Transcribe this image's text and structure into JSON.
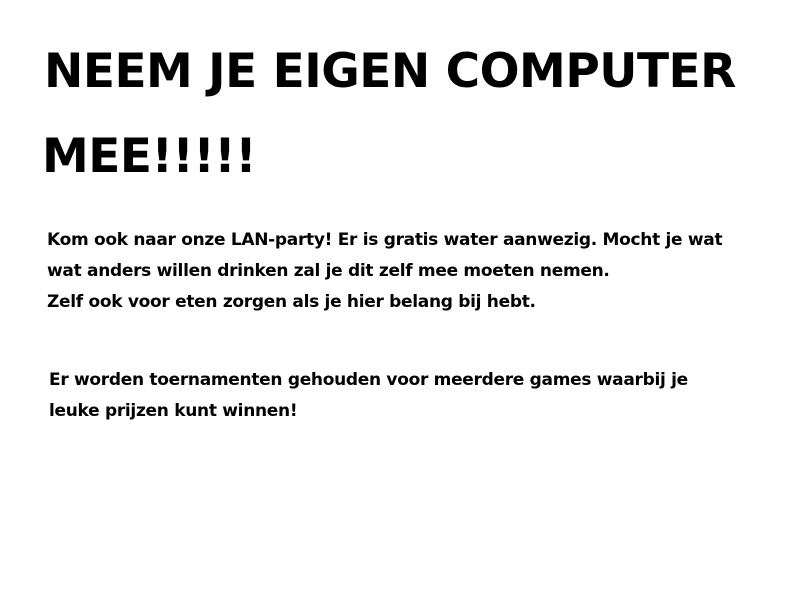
{
  "slide": {
    "title": {
      "line1": "NEEM JE EIGEN COMPUTER",
      "line2": "MEE!!!!!"
    },
    "paragraphs": [
      {
        "lines": [
          "Kom ook naar onze LAN-party! Er is gratis water aanwezig. Mocht je wat",
          "wat anders willen drinken zal je dit zelf mee moeten nemen.",
          "Zelf ook voor eten zorgen als je hier belang bij hebt."
        ]
      },
      {
        "lines": [
          "Er worden toernamenten gehouden voor meerdere games waarbij je",
          "leuke prijzen kunt winnen!"
        ]
      }
    ]
  }
}
